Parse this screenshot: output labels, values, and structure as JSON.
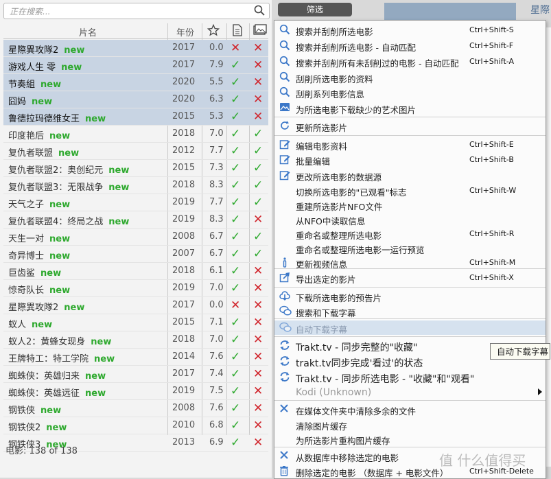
{
  "search": {
    "placeholder": "正在搜索..."
  },
  "table": {
    "headers": {
      "title": "片名",
      "year": "年份"
    },
    "rows": [
      {
        "title": "星際異攻隊2",
        "new": "new",
        "year": "2017",
        "rating": "0.0",
        "c1": "no",
        "c2": "no",
        "selected": true
      },
      {
        "title": "游戏人生 零",
        "new": "new",
        "year": "2017",
        "rating": "7.9",
        "c1": "ok",
        "c2": "no",
        "selected": true
      },
      {
        "title": "节奏組",
        "new": "new",
        "year": "2020",
        "rating": "5.5",
        "c1": "ok",
        "c2": "no",
        "selected": true
      },
      {
        "title": "囧妈",
        "new": "new",
        "year": "2020",
        "rating": "6.3",
        "c1": "ok",
        "c2": "no",
        "selected": true
      },
      {
        "title": "鲁德拉玛德维女王",
        "new": "new",
        "year": "2015",
        "rating": "5.3",
        "c1": "ok",
        "c2": "no",
        "selected": true
      },
      {
        "title": "印度艳后",
        "new": "new",
        "year": "2018",
        "rating": "7.0",
        "c1": "ok",
        "c2": "ok",
        "selected": false
      },
      {
        "title": "复仇者联盟",
        "new": "new",
        "year": "2012",
        "rating": "7.7",
        "c1": "ok",
        "c2": "ok",
        "selected": false
      },
      {
        "title": "复仇者联盟2：奥创纪元",
        "new": "new",
        "year": "2015",
        "rating": "7.3",
        "c1": "ok",
        "c2": "ok",
        "selected": false
      },
      {
        "title": "复仇者联盟3：无限战争",
        "new": "new",
        "year": "2018",
        "rating": "8.3",
        "c1": "ok",
        "c2": "ok",
        "selected": false
      },
      {
        "title": "天气之子",
        "new": "new",
        "year": "2019",
        "rating": "7.7",
        "c1": "ok",
        "c2": "ok",
        "selected": false
      },
      {
        "title": "复仇者联盟4：终局之战",
        "new": "new",
        "year": "2019",
        "rating": "8.3",
        "c1": "ok",
        "c2": "no",
        "selected": false
      },
      {
        "title": "天生一对",
        "new": "new",
        "year": "2008",
        "rating": "6.7",
        "c1": "ok",
        "c2": "ok",
        "selected": false
      },
      {
        "title": "奇异博士",
        "new": "new",
        "year": "2007",
        "rating": "6.7",
        "c1": "ok",
        "c2": "ok",
        "selected": false
      },
      {
        "title": "巨齿鲨",
        "new": "new",
        "year": "2018",
        "rating": "6.1",
        "c1": "ok",
        "c2": "no",
        "selected": false
      },
      {
        "title": "惊奇队长",
        "new": "new",
        "year": "2019",
        "rating": "7.0",
        "c1": "ok",
        "c2": "no",
        "selected": false
      },
      {
        "title": "星際異攻隊2",
        "new": "new",
        "year": "2017",
        "rating": "0.0",
        "c1": "no",
        "c2": "no",
        "selected": false
      },
      {
        "title": "蚁人",
        "new": "new",
        "year": "2015",
        "rating": "7.1",
        "c1": "ok",
        "c2": "no",
        "selected": false
      },
      {
        "title": "蚁人2：黄蜂女现身",
        "new": "new",
        "year": "2018",
        "rating": "7.0",
        "c1": "ok",
        "c2": "no",
        "selected": false
      },
      {
        "title": "王牌特工：特工学院",
        "new": "new",
        "year": "2014",
        "rating": "7.6",
        "c1": "ok",
        "c2": "no",
        "selected": false
      },
      {
        "title": "蜘蛛侠：英雄归来",
        "new": "new",
        "year": "2017",
        "rating": "7.4",
        "c1": "ok",
        "c2": "no",
        "selected": false
      },
      {
        "title": "蜘蛛侠：英雄远征",
        "new": "new",
        "year": "2019",
        "rating": "7.5",
        "c1": "ok",
        "c2": "no",
        "selected": false
      },
      {
        "title": "钢铁侠",
        "new": "new",
        "year": "2008",
        "rating": "7.6",
        "c1": "ok",
        "c2": "no",
        "selected": false
      },
      {
        "title": "钢铁侠2",
        "new": "new",
        "year": "2010",
        "rating": "6.8",
        "c1": "ok",
        "c2": "no",
        "selected": false
      },
      {
        "title": "钢铁侠3",
        "new": "new",
        "year": "2013",
        "rating": "6.9",
        "c1": "ok",
        "c2": "no",
        "selected": false
      }
    ],
    "footer": "电影: 138 of 138"
  },
  "filter": {
    "label": "筛选"
  },
  "right_panel": {
    "title": "星際"
  },
  "menu": {
    "items": [
      {
        "icon": "search-icon",
        "label": "搜索并刮削所选电影",
        "shortcut": "Ctrl+Shift-S"
      },
      {
        "icon": "search-icon",
        "label": "搜索并刮削所选电影 - 自动匹配",
        "shortcut": "Ctrl+Shift-F"
      },
      {
        "icon": "search-icon",
        "label": "搜索并刮削所有未刮削过的电影 - 自动匹配",
        "shortcut": "Ctrl+Shift-A"
      },
      {
        "icon": "search-icon",
        "label": "刮削所选电影的资料",
        "shortcut": ""
      },
      {
        "icon": "search-icon",
        "label": "刮削系列电影信息",
        "shortcut": ""
      },
      {
        "icon": "image-icon",
        "label": "为所选电影下载缺少的艺术图片",
        "shortcut": ""
      },
      {
        "icon": "refresh-icon",
        "label": "更新所选影片",
        "shortcut": ""
      },
      {
        "icon": "edit-icon",
        "label": "编辑电影资料",
        "shortcut": "Ctrl+Shift-E"
      },
      {
        "icon": "edit-icon",
        "label": "批量编辑",
        "shortcut": "Ctrl+Shift-B"
      },
      {
        "icon": "edit-icon",
        "label": "更改所选电影的数据源",
        "shortcut": ""
      },
      {
        "icon": "",
        "label": "切换所选电影的\"已观看\"标志",
        "shortcut": "Ctrl+Shift-W"
      },
      {
        "icon": "",
        "label": "重建所选影片NFO文件",
        "shortcut": ""
      },
      {
        "icon": "",
        "label": "从NFO中读取信息",
        "shortcut": ""
      },
      {
        "icon": "",
        "label": "重命名或整理所选电影",
        "shortcut": "Ctrl+Shift-R"
      },
      {
        "icon": "",
        "label": "重命名或整理所选电影一运行预览",
        "shortcut": ""
      },
      {
        "icon": "info-icon",
        "label": "更新视频信息",
        "shortcut": "Ctrl+Shift-M"
      },
      {
        "icon": "export-icon",
        "label": "导出选定的影片",
        "shortcut": "Ctrl+Shift-X"
      },
      {
        "icon": "download-icon",
        "label": "下载所选电影的预告片",
        "shortcut": ""
      },
      {
        "icon": "subtitle-icon",
        "label": "搜索和下载字幕",
        "shortcut": ""
      },
      {
        "icon": "subtitle-icon",
        "label": "自动下载字幕",
        "shortcut": ""
      },
      {
        "icon": "sync-icon",
        "label": "Trakt.tv - 同步完整的\"收藏\"",
        "shortcut": ""
      },
      {
        "icon": "sync-icon",
        "label": "trakt.tv同步完成'看过'的状态",
        "shortcut": ""
      },
      {
        "icon": "sync-icon",
        "label": "Trakt.tv - 同步所选电影 - \"收藏\"和\"观看\"",
        "shortcut": ""
      },
      {
        "icon": "",
        "label": "Kodi (Unknown)",
        "shortcut": ""
      },
      {
        "icon": "close-x-icon",
        "label": "在媒体文件夹中清除多余的文件",
        "shortcut": ""
      },
      {
        "icon": "",
        "label": "清除图片缓存",
        "shortcut": ""
      },
      {
        "icon": "",
        "label": "为所选影片重构图片缓存",
        "shortcut": ""
      },
      {
        "icon": "close-x-icon",
        "label": "从数据库中移除选定的电影",
        "shortcut": ""
      },
      {
        "icon": "trash-icon",
        "label": "删除选定的电影 （数据库 + 电影文件）",
        "shortcut": "Ctrl+Shift-Delete"
      }
    ]
  },
  "tooltip": "自动下载字幕",
  "watermark": "值 什么值得买"
}
